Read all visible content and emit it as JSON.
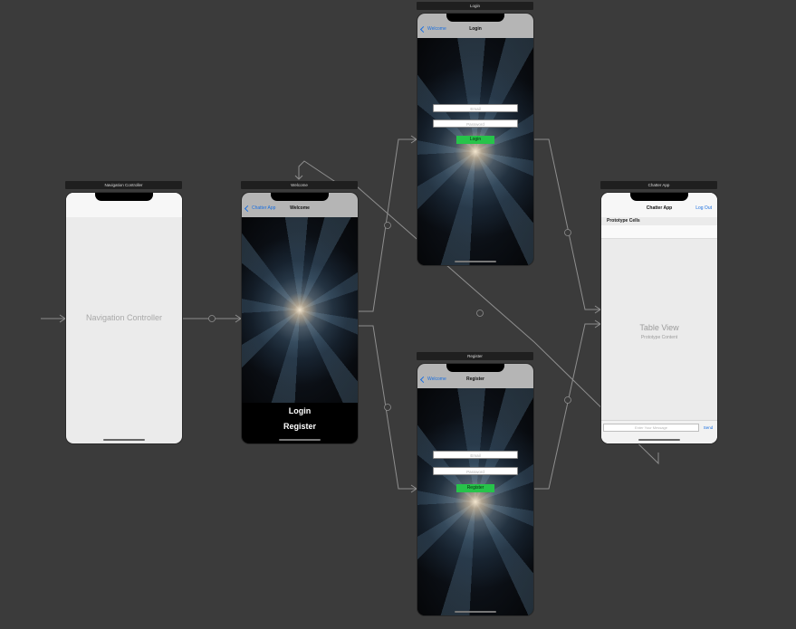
{
  "scenes": {
    "nav_controller": {
      "title": "Navigation Controller",
      "label": "Navigation Controller"
    },
    "welcome": {
      "title": "Welcome",
      "back_label": "Chatter App",
      "nav_title": "Welcome",
      "login_button": "Login",
      "register_button": "Register"
    },
    "login": {
      "title": "Login",
      "back_label": "Welcome",
      "nav_title": "Login",
      "email_placeholder": "Email",
      "password_placeholder": "Password",
      "submit_label": "Login"
    },
    "register": {
      "title": "Register",
      "back_label": "Welcome",
      "nav_title": "Register",
      "email_placeholder": "Email",
      "password_placeholder": "Password",
      "submit_label": "Register"
    },
    "chat": {
      "title": "Chatter App",
      "nav_title": "Chatter App",
      "logout_label": "Log Out",
      "prototype_cells_label": "Prototype Cells",
      "table_view_label": "Table View",
      "prototype_content_label": "Prototype Content",
      "message_placeholder": "Enter Your Message",
      "send_label": "Send"
    }
  },
  "colors": {
    "canvas": "#3b3b3b",
    "accent_blue": "#1a6fe0",
    "button_green": "#27c34a",
    "segue_line": "#8a8a8a"
  },
  "icons": {
    "back": "chevron-left-icon",
    "segue": "segue-icon",
    "entry_arrow": "entry-arrow-icon"
  }
}
